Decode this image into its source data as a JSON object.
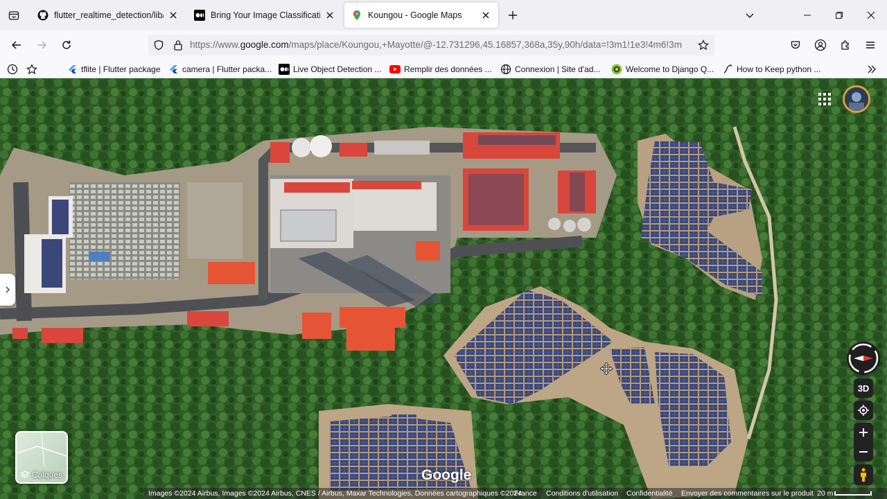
{
  "browser": {
    "tabs": [
      {
        "title": "flutter_realtime_detection/lib/m",
        "icon": "github-icon",
        "active": false
      },
      {
        "title": "Bring Your Image Classification",
        "icon": "medium-icon",
        "active": false
      },
      {
        "title": "Koungou - Google Maps",
        "icon": "google-maps-icon",
        "active": true
      }
    ],
    "url": {
      "prefix": "https://www.",
      "domain": "google.com",
      "path": "/maps/place/Koungou,+Mayotte/@-12.731296,45.16857,368a,35y,90h/data=!3m1!1e3!4m6!3m"
    },
    "bookmarks": [
      {
        "label": "tflite | Flutter package",
        "icon": "flutter-icon"
      },
      {
        "label": "camera | Flutter packa...",
        "icon": "flutter-icon"
      },
      {
        "label": "Live Object Detection ...",
        "icon": "medium-icon"
      },
      {
        "label": "Remplir des données ...",
        "icon": "youtube-icon"
      },
      {
        "label": "Connexion | Site d'ad...",
        "icon": "globe-icon"
      },
      {
        "label": "Welcome to Django Q...",
        "icon": "django-icon"
      },
      {
        "label": "How to Keep python ...",
        "icon": "python-icon"
      }
    ]
  },
  "map": {
    "layers_label": "Calques",
    "tilt_label": "3D",
    "logo": "Google",
    "attribution": {
      "imagery": "Images ©2024 Airbus, Images ©2024 Airbus, CNES / Airbus, Maxar Technologies, Données cartographiques ©2024",
      "region": "France",
      "terms": "Conditions d'utilisation",
      "privacy": "Confidentialité",
      "feedback": "Envoyer des commentaires sur le produit",
      "scale": "20 m"
    }
  },
  "colors": {
    "accent": "#1a73e8",
    "roof_red": "#d9473c",
    "panel_blue": "#3d4a78"
  }
}
